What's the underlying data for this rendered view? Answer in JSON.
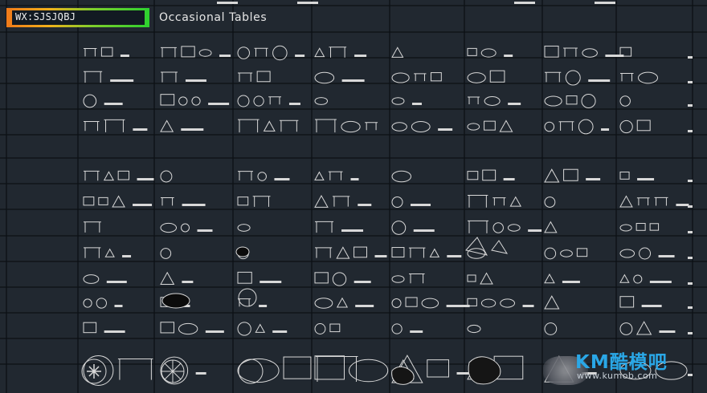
{
  "badge": {
    "text": "WX:SJSJQBJ"
  },
  "title": "Occasional Tables",
  "watermark": {
    "brand": "KM酷模吧",
    "url": "www.kumob.com"
  },
  "colors": {
    "background": "#212830",
    "grid": "#0c1014",
    "linework": "#d8d8d8",
    "brand": "#2aa7e6"
  }
}
